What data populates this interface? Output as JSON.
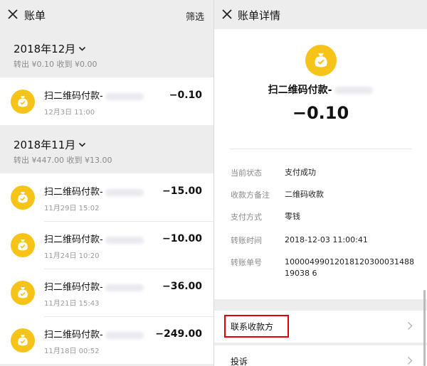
{
  "bill_list": {
    "header": {
      "title": "账单",
      "filter_label": "筛选"
    },
    "months": [
      {
        "month": "2018年12月",
        "summary": "转出 ¥0.10 收到 ¥0.00",
        "items": [
          {
            "title": "扫二维码付款-",
            "date": "12月3日 11:00",
            "amount": "−0.10"
          }
        ]
      },
      {
        "month": "2018年11月",
        "summary": "转出 ¥447.00 收到 ¥13.00",
        "items": [
          {
            "title": "扫二维码付款-",
            "date": "11月29日 15:02",
            "amount": "−15.00"
          },
          {
            "title": "扫二维码付款-",
            "date": "11月24日 10:20",
            "amount": "−10.00"
          },
          {
            "title": "扫二维码付款-",
            "date": "11月21日 15:43",
            "amount": "−36.00"
          },
          {
            "title": "扫二维码付款-",
            "date": "11月18日 00:52",
            "amount": "−249.00"
          }
        ]
      }
    ]
  },
  "detail": {
    "header": {
      "title": "账单详情"
    },
    "title": "扫二维码付款-",
    "amount": "−0.10",
    "fields": [
      {
        "key": "当前状态",
        "value": "支付成功"
      },
      {
        "key": "收款方备注",
        "value": "二维码收款"
      },
      {
        "key": "支付方式",
        "value": "零钱"
      },
      {
        "key": "转账时间",
        "value": "2018-12-03 11:00:41"
      },
      {
        "key": "转账单号",
        "value": "1000049901201812030003148819038 6"
      }
    ],
    "contact_label": "联系收款方",
    "complaint_label": "投诉"
  },
  "colors": {
    "accent_yellow": "#f6c318",
    "highlight_red": "#e10000",
    "background_gray": "#ededed"
  },
  "icons": {
    "close": "close-icon",
    "chevron_down": "chevron-down-icon",
    "chevron_right": "chevron-right-icon",
    "bag": "money-bag-icon"
  }
}
